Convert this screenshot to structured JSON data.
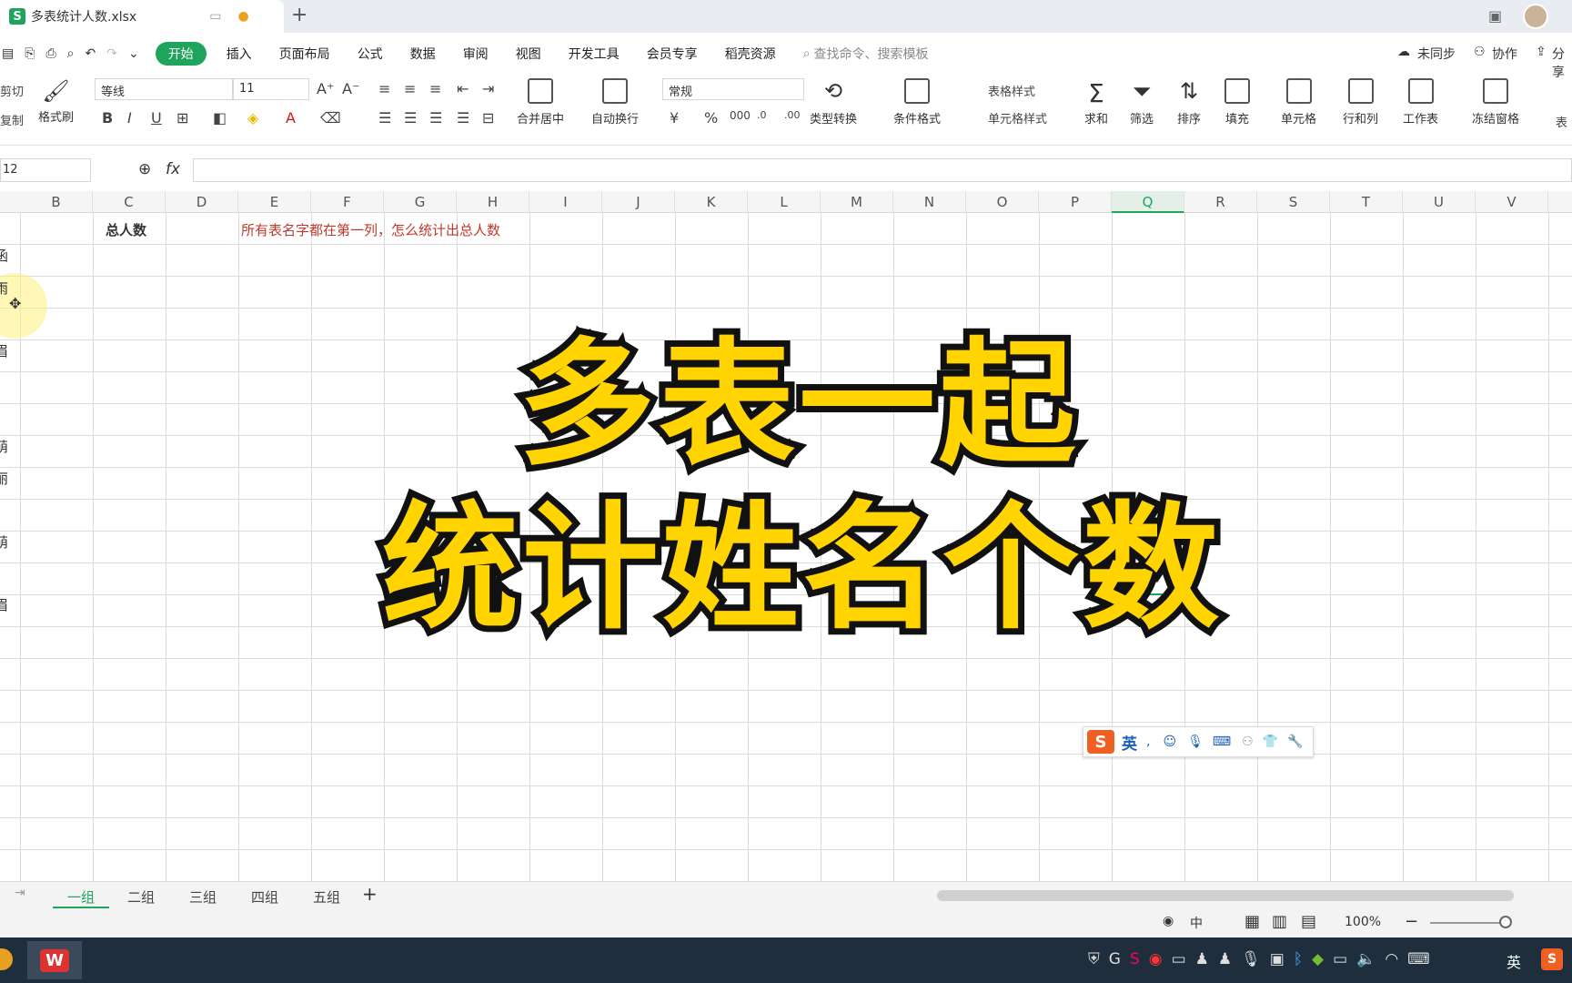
{
  "file": {
    "title": "多表统计人数.xlsx",
    "logo": "S"
  },
  "menu": [
    "开始",
    "插入",
    "页面布局",
    "公式",
    "数据",
    "审阅",
    "视图",
    "开发工具",
    "会员专享",
    "稻壳资源"
  ],
  "search": "查找命令、搜索模板",
  "top_right": {
    "sync": "未同步",
    "collab": "协作",
    "share": "分享"
  },
  "ribbon": {
    "clip": [
      "剪切",
      "复制"
    ],
    "format_painter": "格式刷",
    "font_name": "等线",
    "font_size": "11",
    "number_format": "常规",
    "merge": "合并居中",
    "wrap": "自动换行",
    "convert": "类型转换",
    "cond": "条件格式",
    "table_style": "表格样式",
    "cell_style": "单元格样式",
    "sum": "求和",
    "filter": "筛选",
    "sort": "排序",
    "fill": "填充",
    "cell": "单元格",
    "rowcol": "行和列",
    "sheet": "工作表",
    "freeze": "冻结窗格",
    "table": "表"
  },
  "namebox": "12",
  "fx": "fx",
  "columns": [
    "B",
    "C",
    "D",
    "E",
    "F",
    "G",
    "H",
    "I",
    "J",
    "K",
    "L",
    "M",
    "N",
    "O",
    "P",
    "Q",
    "R",
    "S",
    "T",
    "U",
    "V"
  ],
  "cells": {
    "c1": "总人数",
    "e1": "所有表名字都在第一列，怎么统计出总人数"
  },
  "left_chars": [
    "函",
    "雨",
    "眉",
    "萌",
    "丽",
    "萌",
    "眉"
  ],
  "overlay": {
    "line1": "多表一起",
    "line2": "统计姓名个数"
  },
  "ime": {
    "logo": "S",
    "lang": "英"
  },
  "sheets": [
    "一组",
    "二组",
    "三组",
    "四组",
    "五组"
  ],
  "status": {
    "zoom": "100%",
    "lang": "中"
  },
  "taskbar": {
    "ime": "英"
  },
  "colors": {
    "accent": "#1fa45b",
    "overlay": "#ffd400",
    "hint": "#c0392b"
  }
}
